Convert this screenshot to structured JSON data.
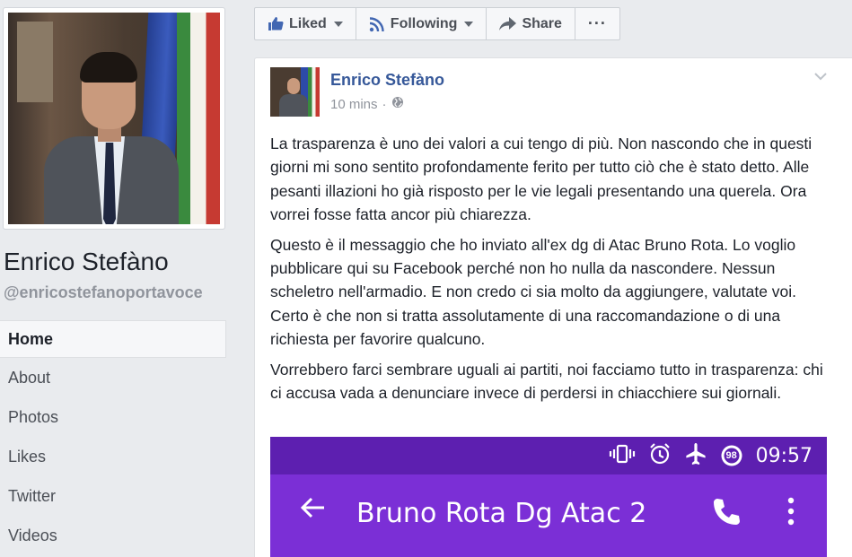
{
  "page": {
    "name": "Enrico Stefàno",
    "handle": "@enricostefanoportavoce"
  },
  "nav": {
    "items": [
      {
        "label": "Home",
        "active": true
      },
      {
        "label": "About"
      },
      {
        "label": "Photos"
      },
      {
        "label": "Likes"
      },
      {
        "label": "Twitter"
      },
      {
        "label": "Videos"
      }
    ]
  },
  "actions": {
    "liked_label": "Liked",
    "following_label": "Following",
    "share_label": "Share",
    "more_label": "···"
  },
  "post": {
    "author": "Enrico Stefàno",
    "time": "10 mins",
    "separator": "·",
    "paragraphs": [
      "La trasparenza è uno dei valori a cui tengo di più. Non nascondo che in questi giorni mi sono sentito profondamente ferito per tutto ciò che è stato detto. Alle pesanti illazioni ho già risposto per le vie legali presentando una querela. Ora vorrei fosse fatta ancor più chiarezza.",
      "Questo è il messaggio che ho inviato all'ex dg di Atac Bruno Rota. Lo voglio pubblicare qui su Facebook perché non ho nulla da nascondere. Nessun scheletro nell'armadio. E non credo ci sia molto da aggiungere, valutate voi. Certo è che non si tratta assolutamente di una raccomandazione o di una richiesta per favorire qualcuno.",
      "Vorrebbero farci sembrare uguali ai partiti, noi facciamo tutto in trasparenza: chi ci accusa vada a denunciare invece di perdersi in chiacchiere sui giornali."
    ],
    "embed": {
      "status_time": "09:57",
      "battery": "98",
      "contact_name": "Bruno Rota Dg Atac 2"
    }
  },
  "colors": {
    "link_blue": "#365899",
    "embed_purple": "#7b2fd6",
    "embed_status_purple": "#5d1fb0"
  },
  "icons": [
    "thumbs-up-icon",
    "rss-icon",
    "share-arrow-icon",
    "chevron-down-icon",
    "globe-icon",
    "vibrate-icon",
    "alarm-icon",
    "airplane-icon",
    "battery-icon",
    "back-arrow-icon",
    "phone-icon",
    "kebab-menu-icon"
  ]
}
